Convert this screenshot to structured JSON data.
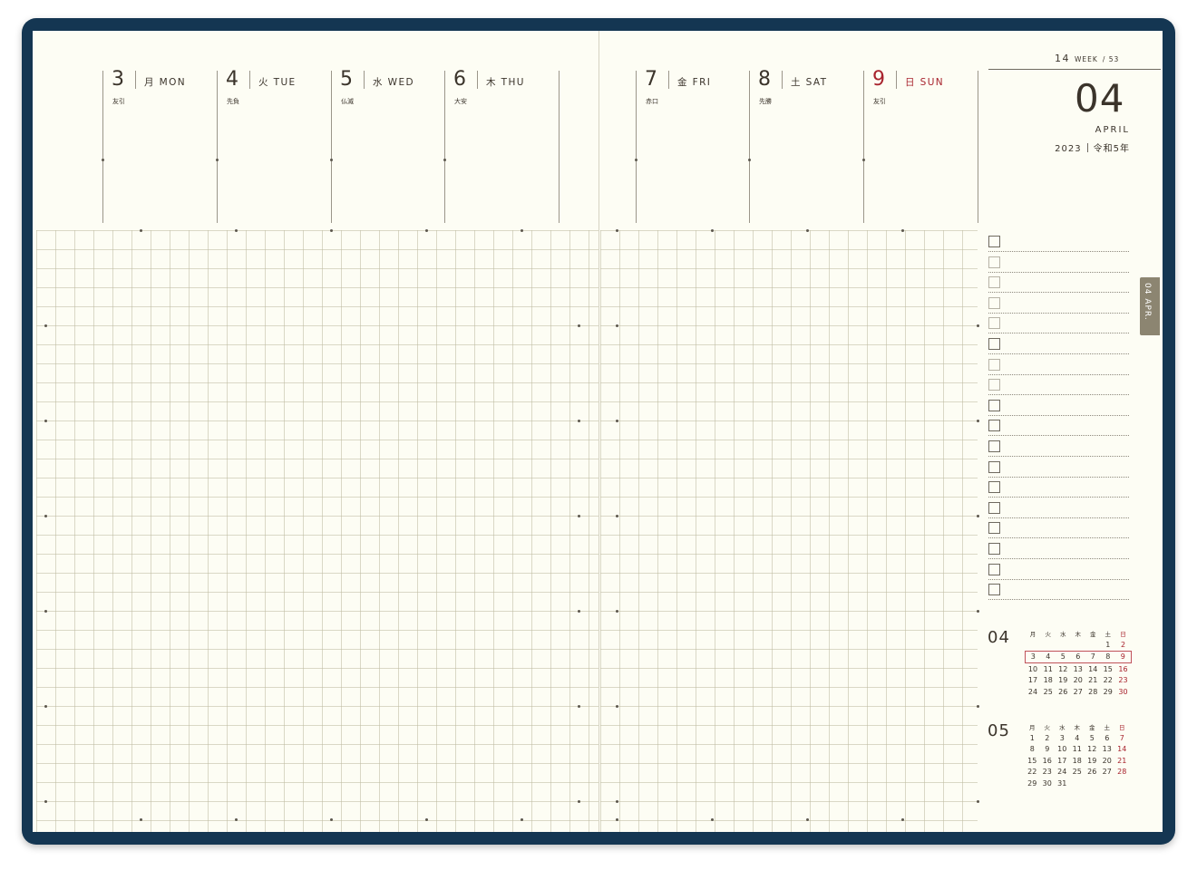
{
  "week": {
    "number": "14",
    "label": "WEEK",
    "total": "/ 53"
  },
  "month": {
    "number": "04",
    "name": "APRIL",
    "year": "2023",
    "era": "令和5年"
  },
  "tab": {
    "label": "04 APR."
  },
  "days": [
    {
      "num": "3",
      "kanji": "月",
      "name": "MON",
      "rokuyo": "友引",
      "sunday": false
    },
    {
      "num": "4",
      "kanji": "火",
      "name": "TUE",
      "rokuyo": "先負",
      "sunday": false
    },
    {
      "num": "5",
      "kanji": "水",
      "name": "WED",
      "rokuyo": "仏滅",
      "sunday": false
    },
    {
      "num": "6",
      "kanji": "木",
      "name": "THU",
      "rokuyo": "大安",
      "sunday": false
    },
    {
      "num": "7",
      "kanji": "金",
      "name": "FRI",
      "rokuyo": "赤口",
      "sunday": false
    },
    {
      "num": "8",
      "kanji": "土",
      "name": "SAT",
      "rokuyo": "先勝",
      "sunday": false
    },
    {
      "num": "9",
      "kanji": "日",
      "name": "SUN",
      "rokuyo": "友引",
      "sunday": true
    }
  ],
  "checklist_count": 18,
  "mini_calendars": [
    {
      "month": "04",
      "weekdays": [
        "月",
        "火",
        "水",
        "木",
        "金",
        "土",
        "日"
      ],
      "weeks": [
        [
          "",
          "",
          "",
          "",
          "",
          "1",
          "2"
        ],
        [
          "3",
          "4",
          "5",
          "6",
          "7",
          "8",
          "9"
        ],
        [
          "10",
          "11",
          "12",
          "13",
          "14",
          "15",
          "16"
        ],
        [
          "17",
          "18",
          "19",
          "20",
          "21",
          "22",
          "23"
        ],
        [
          "24",
          "25",
          "26",
          "27",
          "28",
          "29",
          "30"
        ]
      ],
      "highlight_week": 1
    },
    {
      "month": "05",
      "weekdays": [
        "月",
        "火",
        "水",
        "木",
        "金",
        "土",
        "日"
      ],
      "weeks": [
        [
          "1",
          "2",
          "3",
          "4",
          "5",
          "6",
          "7"
        ],
        [
          "8",
          "9",
          "10",
          "11",
          "12",
          "13",
          "14"
        ],
        [
          "15",
          "16",
          "17",
          "18",
          "19",
          "20",
          "21"
        ],
        [
          "22",
          "23",
          "24",
          "25",
          "26",
          "27",
          "28"
        ],
        [
          "29",
          "30",
          "31",
          "",
          "",
          "",
          ""
        ]
      ],
      "highlight_week": -1
    }
  ],
  "colors": {
    "cover": "#143652",
    "paper": "#fdfdf4",
    "sunday": "#a8232d",
    "tab": "#8c8571"
  }
}
